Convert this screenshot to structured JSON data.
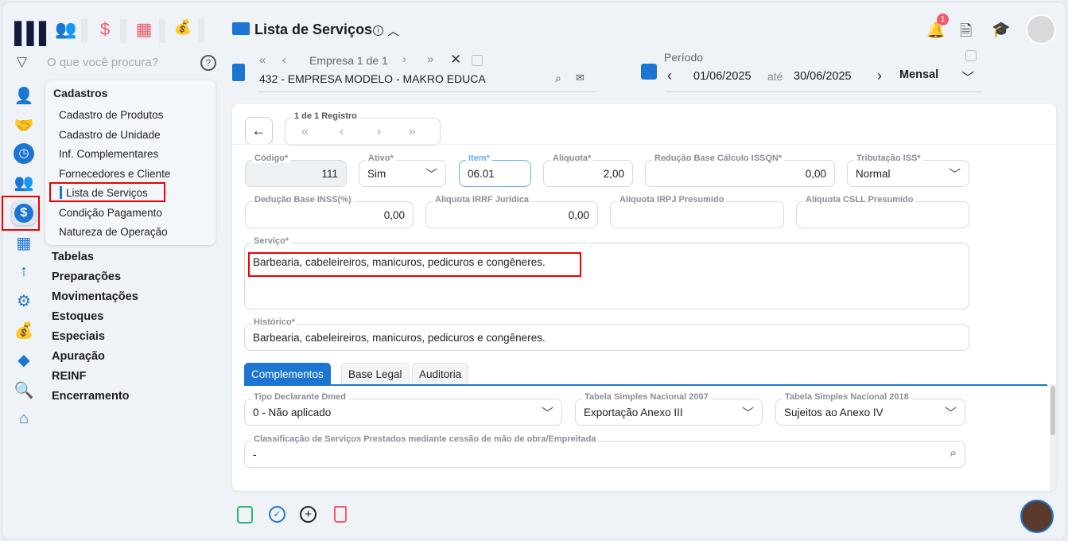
{
  "search": {
    "placeholder": "O que você procura?"
  },
  "menu": {
    "title": "Cadastros",
    "items": [
      "Cadastro de Produtos",
      "Cadastro de Unidade",
      "Inf. Complementares",
      "Fornecedores e Cliente",
      "Lista de Serviços",
      "Condição Pagamento",
      "Natureza de Operação"
    ]
  },
  "sections": [
    "Tabelas",
    "Preparações",
    "Movimentações",
    "Estoques",
    "Especiais",
    "Apuração",
    "REINF",
    "Encerramento"
  ],
  "header": {
    "title": "Lista de Serviços",
    "company_nav": "Empresa 1 de 1",
    "company": "432 - EMPRESA MODELO - MAKRO EDUCA",
    "periodo_label": "Período",
    "date_from": "01/06/2025",
    "ate": "até",
    "date_to": "30/06/2025",
    "period_type": "Mensal",
    "notif_count": "1"
  },
  "record": {
    "nav_label": "1 de 1 Registro"
  },
  "form": {
    "codigo": {
      "label": "Código*",
      "value": "111"
    },
    "ativo": {
      "label": "Ativo*",
      "value": "Sim"
    },
    "item": {
      "label": "Item*",
      "value": "06.01"
    },
    "aliquota": {
      "label": "Alíquota*",
      "value": "2,00"
    },
    "reducao": {
      "label": "Redução Base Cálculo ISSQN*",
      "value": "0,00"
    },
    "tributacao": {
      "label": "Tributação ISS*",
      "value": "Normal"
    },
    "deducao": {
      "label": "Dedução Base INSS(%)",
      "value": "0,00"
    },
    "irrf": {
      "label": "Alíquota IRRF Jurídica",
      "value": "0,00"
    },
    "irpj": {
      "label": "Alíquota IRPJ Presumido",
      "value": ""
    },
    "csll": {
      "label": "Alíquota CSLL Presumido",
      "value": ""
    },
    "servico": {
      "label": "Serviço*",
      "value": "Barbearia, cabeleireiros, manicuros, pedicuros e congêneres."
    },
    "historico": {
      "label": "Histórico*",
      "value": "Barbearia, cabeleireiros, manicuros, pedicuros e congêneres."
    }
  },
  "tabs": [
    "Complementos",
    "Base Legal",
    "Auditoria"
  ],
  "complementos": {
    "dmed": {
      "label": "Tipo Declarante Dmed",
      "value": "0 - Não aplicado"
    },
    "sn2007": {
      "label": "Tabela Simples Nacional 2007",
      "value": "Exportação Anexo III"
    },
    "sn2018": {
      "label": "Tabela Simples Nacional 2018",
      "value": "Sujeitos ao Anexo IV"
    },
    "classif": {
      "label": "Classificação de Serviços Prestados mediante cessão de mão de obra/Empreitada",
      "value": "-"
    }
  },
  "colors": {
    "accent": "#1c75d0",
    "danger": "#e00000"
  }
}
